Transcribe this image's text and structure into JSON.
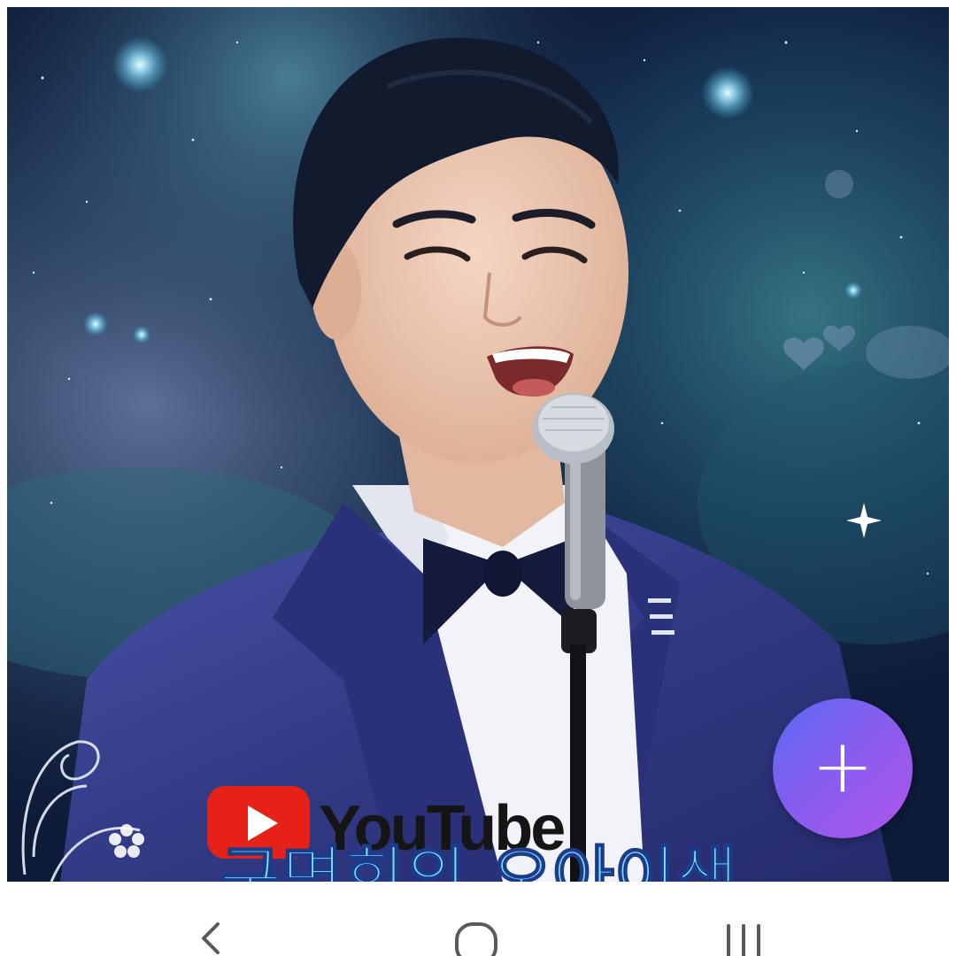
{
  "photo": {
    "alt_description": "",
    "badge_brand": "YouTube",
    "bottom_caption": "구면희의 오아이생",
    "colors": {
      "space_dark": "#0d1a38",
      "nebula_teal": "#3f7a8a",
      "suit_blue": "#343b82",
      "youtube_red": "#e62117"
    }
  },
  "fab": {
    "icon": "plus-icon",
    "symbol": "+",
    "color_start": "#5b6af2",
    "color_end": "#b055e8"
  },
  "navigation": {
    "back_icon": "chevron-left-icon",
    "home_icon": "home-outline-icon",
    "recents_icon": "recent-apps-icon"
  }
}
